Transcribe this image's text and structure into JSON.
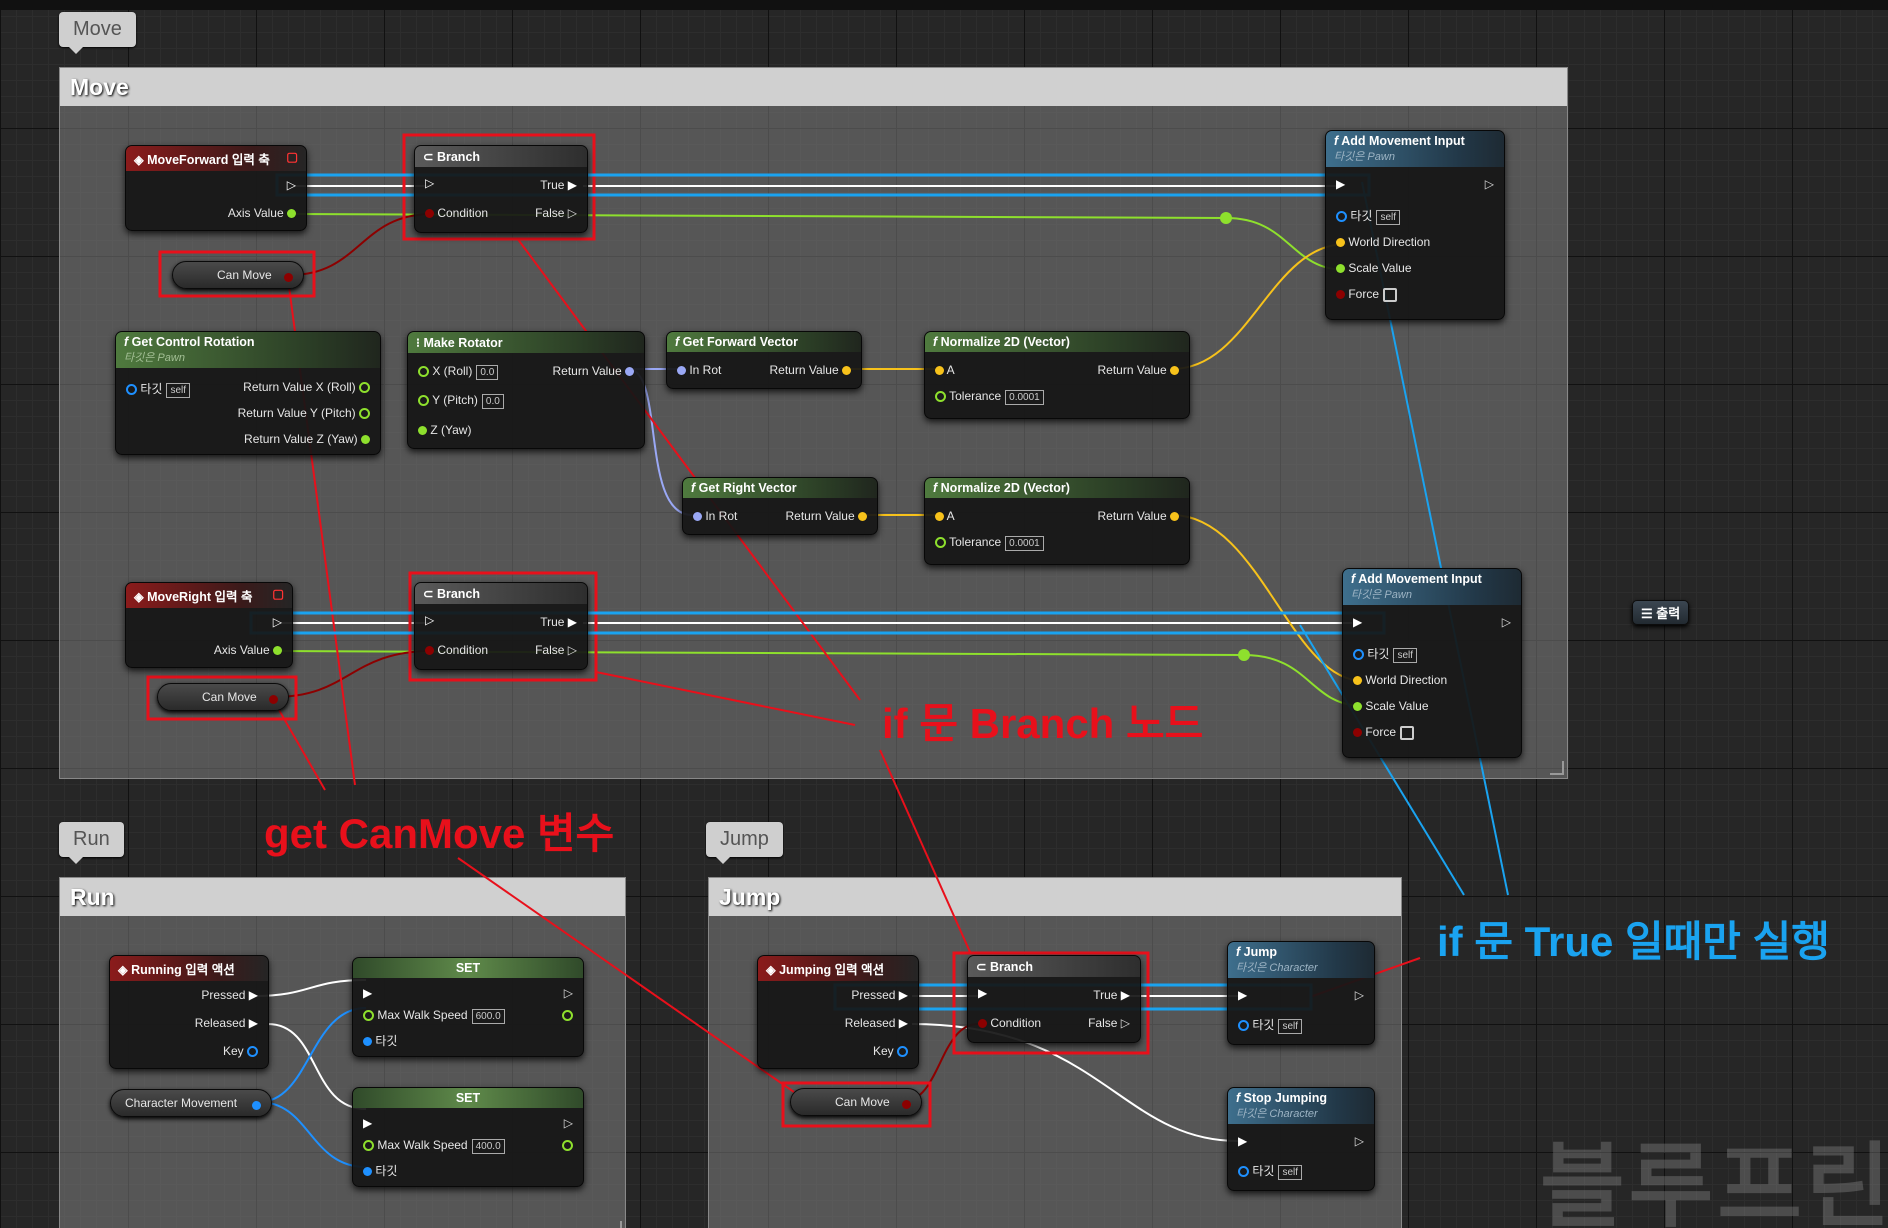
{
  "groups": {
    "move": {
      "tab": "Move",
      "title": "Move"
    },
    "run": {
      "tab": "Run",
      "title": "Run"
    },
    "jump": {
      "tab": "Jump",
      "title": "Jump"
    }
  },
  "nodes": {
    "move_forward": {
      "title": "MoveForward 입력 축",
      "axis": "Axis Value"
    },
    "move_right": {
      "title": "MoveRight 입력 축",
      "axis": "Axis Value"
    },
    "branch": {
      "title": "Branch",
      "true_label": "True",
      "false_label": "False",
      "condition": "Condition"
    },
    "can_move": "Can Move",
    "get_control_rotation": {
      "title": "Get Control Rotation",
      "subtitle": "타깃은 Pawn",
      "target": "타깃",
      "target_value": "self",
      "out_x": "Return Value X (Roll)",
      "out_y": "Return Value Y (Pitch)",
      "out_z": "Return Value Z (Yaw)"
    },
    "make_rotator": {
      "title": "Make Rotator",
      "x": "X (Roll)",
      "x_value": "0.0",
      "y": "Y (Pitch)",
      "y_value": "0.0",
      "z": "Z (Yaw)",
      "ret": "Return Value"
    },
    "get_forward_vector": {
      "title": "Get Forward Vector",
      "in": "In Rot",
      "ret": "Return Value"
    },
    "get_right_vector": {
      "title": "Get Right Vector",
      "in": "In Rot",
      "ret": "Return Value"
    },
    "normalize": {
      "title": "Normalize 2D (Vector)",
      "a": "A",
      "tol": "Tolerance",
      "tol_value": "0.0001",
      "ret": "Return Value"
    },
    "add_movement": {
      "title": "Add Movement Input",
      "subtitle": "타깃은 Pawn",
      "target": "타깃",
      "target_value": "self",
      "world": "World Direction",
      "scale": "Scale Value",
      "force": "Force"
    },
    "output": "출력",
    "running": {
      "title": "Running 입력 액션",
      "pressed": "Pressed",
      "released": "Released",
      "key": "Key"
    },
    "char_movement": "Character Movement",
    "set": {
      "title": "SET",
      "speed": "Max Walk Speed",
      "speed_a": "600.0",
      "speed_b": "400.0",
      "target": "타깃"
    },
    "jumping": {
      "title": "Jumping 입력 액션",
      "pressed": "Pressed",
      "released": "Released",
      "key": "Key"
    },
    "jump": {
      "title": "Jump",
      "subtitle": "타깃은 Character",
      "target": "타깃",
      "target_value": "self"
    },
    "stop_jumping": {
      "title": "Stop Jumping",
      "subtitle": "타깃은 Character",
      "target": "타깃",
      "target_value": "self"
    }
  },
  "annotations": {
    "branch_node": "if 문 Branch 노드",
    "get_canmove": "get CanMove 변수",
    "true_only": "if 문 True 일때만 실행"
  },
  "watermark": "블루프린",
  "colors": {
    "annotation_red": "#e8101b",
    "annotation_blue": "#1aa3f0",
    "exec_wire": "#ffffff",
    "float_pin": "#8ee02d",
    "bool_pin": "#8c0000",
    "vector_pin": "#f7c21b",
    "rotator_pin": "#9aa8f5",
    "object_pin": "#1e90ff"
  }
}
